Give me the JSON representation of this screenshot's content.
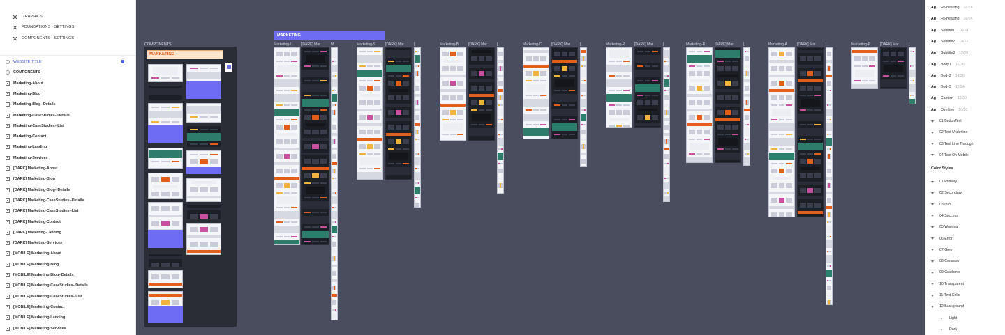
{
  "left_panel": {
    "pages": [
      {
        "label": "GRAPHICS",
        "icon": "figma-page-icon"
      },
      {
        "label": "FOUNDATIONS - SETTINGS",
        "icon": "figma-page-icon"
      },
      {
        "label": "COMPONENTS - SETTINGS",
        "icon": "figma-page-icon"
      }
    ],
    "layers": [
      {
        "label": "WEBSITE TITLE",
        "type": "component",
        "selected": true,
        "locked": true
      },
      {
        "label": "COMPONENTS",
        "type": "component"
      },
      {
        "label": "Marketing-About",
        "type": "frame"
      },
      {
        "label": "Marketing-Blog",
        "type": "frame"
      },
      {
        "label": "Marketing-Blog--Details",
        "type": "frame"
      },
      {
        "label": "Marketing-CaseStudies--Details",
        "type": "frame"
      },
      {
        "label": "Marketing-CaseStudies--List",
        "type": "frame"
      },
      {
        "label": "Marketing-Contact",
        "type": "frame"
      },
      {
        "label": "Marketing-Landing",
        "type": "frame"
      },
      {
        "label": "Marketing-Services",
        "type": "frame"
      },
      {
        "label": "[DARK] Marketing-About",
        "type": "frame"
      },
      {
        "label": "[DARK] Marketing-Blog",
        "type": "frame"
      },
      {
        "label": "[DARK] Marketing-Blog--Details",
        "type": "frame"
      },
      {
        "label": "[DARK] Marketing-CaseStudies--Details",
        "type": "frame"
      },
      {
        "label": "[DARK] Marketing-CaseStudies--List",
        "type": "frame"
      },
      {
        "label": "[DARK] Marketing-Contact",
        "type": "frame"
      },
      {
        "label": "[DARK] Marketing-Landing",
        "type": "frame"
      },
      {
        "label": "[DARK] Marketing-Services",
        "type": "frame"
      },
      {
        "label": "[MOBILE] Marketing-About",
        "type": "frame"
      },
      {
        "label": "[MOBILE] Marketing-Blog",
        "type": "frame"
      },
      {
        "label": "[MOBILE] Marketing-Blog--Details",
        "type": "frame"
      },
      {
        "label": "[MOBILE] Marketing-CaseStudies--Details",
        "type": "frame"
      },
      {
        "label": "[MOBILE] Marketing-CaseStudies--List",
        "type": "frame"
      },
      {
        "label": "[MOBILE] Marketing-Contact",
        "type": "frame"
      },
      {
        "label": "[MOBILE] Marketing-Landing",
        "type": "frame"
      },
      {
        "label": "[MOBILE] Marketing-Services",
        "type": "frame"
      }
    ]
  },
  "canvas": {
    "background": "#4a4d5e",
    "components_label": "COMPONENTS",
    "components_chip": "MARKETING",
    "marketing_banner": "MARKETING",
    "accent": "#6d6cf3",
    "frame_labels": [
      "Marketing-/...",
      "[DARK] Mar...",
      "M...",
      "Marketing-S...",
      "[DARK] Mar...",
      "[...",
      "Marketing-B...",
      "[DARK] Mar...",
      "[...",
      "Marketing-C...",
      "[DARK] Mar...",
      "[...",
      "Marketing-R...",
      "[DARK] Mar...",
      "[...",
      "Marketing-R...",
      "[DARK] Mar...",
      "[...",
      "Marketing-A...",
      "[DARK] Mar...",
      "[...",
      "Marketing-P...",
      "[DARK] Mar...",
      "[..."
    ]
  },
  "right_panel": {
    "text_styles": [
      {
        "ag": "Ag",
        "name": "H5 heading",
        "meta": "18/26"
      },
      {
        "ag": "Ag",
        "name": "H6 heading",
        "meta": "16/24"
      },
      {
        "ag": "Ag",
        "name": "Subtitle1",
        "meta": "16/24"
      },
      {
        "ag": "Ag",
        "name": "Subtitle2",
        "meta": "14/22"
      },
      {
        "ag": "Ag",
        "name": "Subtitle3",
        "meta": "12/20"
      },
      {
        "ag": "Ag",
        "name": "Body1",
        "meta": "16/26"
      },
      {
        "ag": "Ag",
        "name": "Body2",
        "meta": "14/26"
      },
      {
        "ag": "Ag",
        "name": "Body3",
        "meta": "12/24"
      },
      {
        "ag": "Ag",
        "name": "Caption",
        "meta": "12/20"
      },
      {
        "ag": "Ag",
        "name": "Overline",
        "meta": "10/20"
      }
    ],
    "text_groups": [
      "01 ButtonText",
      "02 Text Underline",
      "03 Text Line Through",
      "04 Text On Mobile"
    ],
    "color_styles_heading": "Color Styles",
    "color_groups": [
      "01 Primary",
      "02 Secondary",
      "03 Info",
      "04 Success",
      "05 Warning",
      "06 Error",
      "07 Grey",
      "08 Common",
      "09 Gradients",
      "10 Transparent",
      "11 Text Color",
      "12 Background"
    ],
    "background_children": [
      "Light",
      "Dark"
    ]
  }
}
